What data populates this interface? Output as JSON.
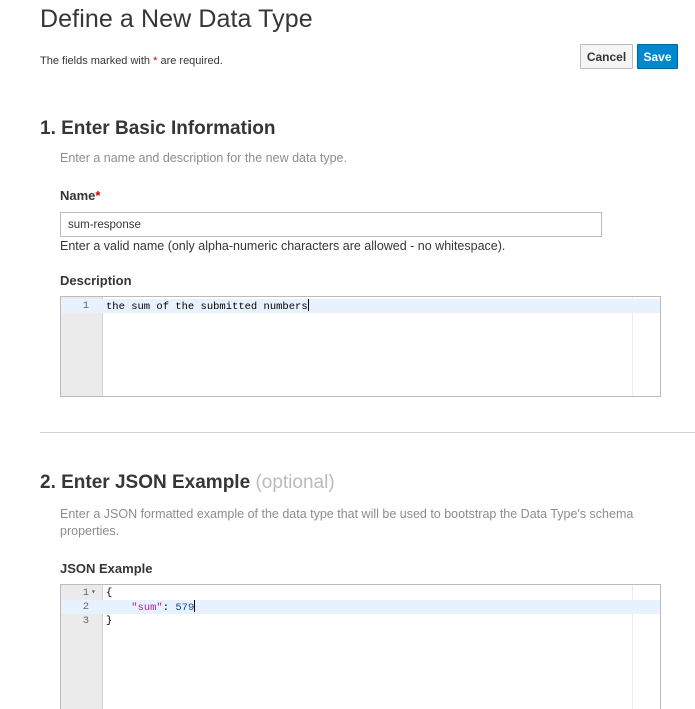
{
  "page": {
    "title": "Define a New Data Type",
    "required_note_prefix": "The fields marked with ",
    "required_star": "*",
    "required_note_suffix": " are required."
  },
  "actions": {
    "cancel_label": "Cancel",
    "save_label": "Save"
  },
  "section1": {
    "title": "1. Enter Basic Information",
    "description": "Enter a name and description for the new data type.",
    "name_label": "Name",
    "name_required_mark": "*",
    "name_value": "sum-response",
    "name_help": "Enter a valid name (only alpha-numeric characters are allowed - no whitespace).",
    "description_label": "Description",
    "description_editor": {
      "lines": [
        {
          "num": "1",
          "text": "the sum of the submitted numbers"
        }
      ]
    }
  },
  "section2": {
    "title": "2. Enter JSON Example",
    "optional_label": "(optional)",
    "description": "Enter a JSON formatted example of the data type that will be used to bootstrap the Data Type's schema properties.",
    "json_label": "JSON Example",
    "json_editor": {
      "lines": [
        {
          "num": "1",
          "fold": "▾",
          "text": "{"
        },
        {
          "num": "2",
          "indent": "    ",
          "key": "\"sum\"",
          "sep": ": ",
          "value": "579"
        },
        {
          "num": "3",
          "text": "}"
        }
      ]
    }
  },
  "colors": {
    "primary": "#0088ce",
    "required": "#cc0000",
    "active_line": "#e8f2fe"
  }
}
